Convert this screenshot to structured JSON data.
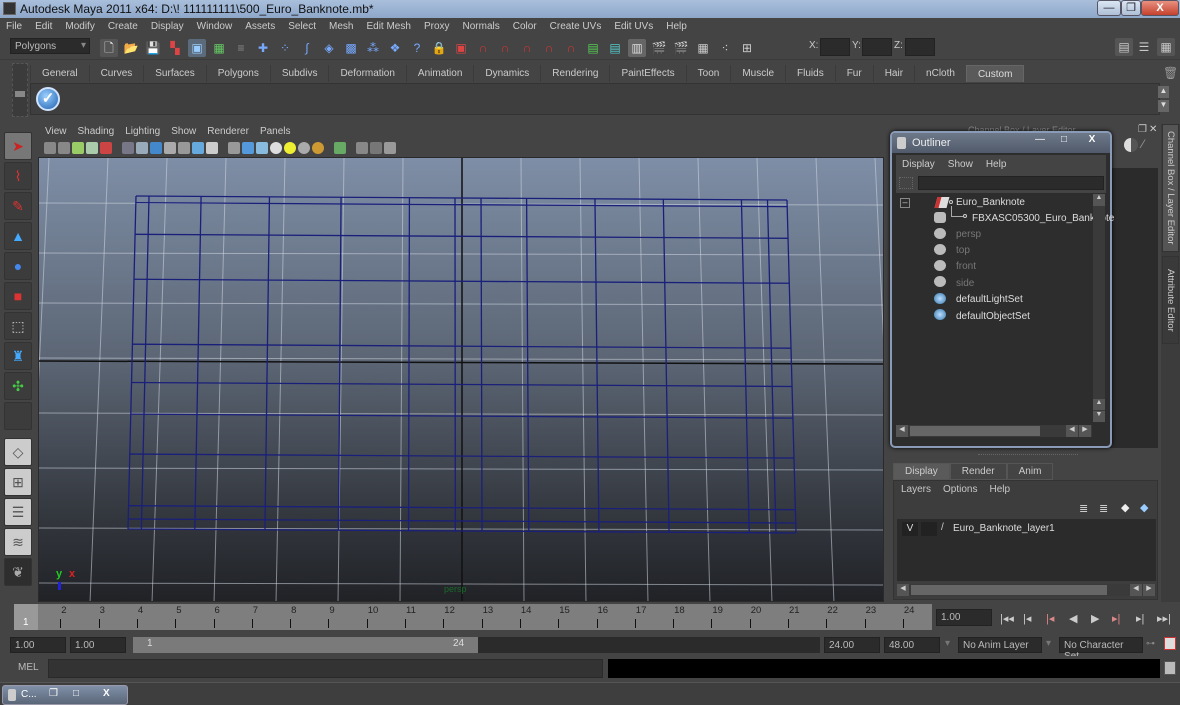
{
  "window": {
    "title": "Autodesk Maya 2011 x64: D:\\! 111111111\\500_Euro_Banknote.mb*",
    "minimize": "—",
    "restore": "❐",
    "close": "X"
  },
  "menubar": [
    "File",
    "Edit",
    "Modify",
    "Create",
    "Display",
    "Window",
    "Assets",
    "Select",
    "Mesh",
    "Edit Mesh",
    "Proxy",
    "Normals",
    "Color",
    "Create UVs",
    "Edit UVs",
    "Help"
  ],
  "statusline": {
    "mode": "Polygons",
    "x_label": "X:",
    "y_label": "Y:",
    "z_label": "Z:",
    "x_value": "",
    "y_value": "",
    "z_value": ""
  },
  "shelf": {
    "tabs": [
      "General",
      "Curves",
      "Surfaces",
      "Polygons",
      "Subdivs",
      "Deformation",
      "Animation",
      "Dynamics",
      "Rendering",
      "PaintEffects",
      "Toon",
      "Muscle",
      "Fluids",
      "Fur",
      "Hair",
      "nCloth",
      "Custom"
    ],
    "active_tab": "Custom",
    "items": [
      {
        "icon": "checkmark-shelf-icon"
      }
    ]
  },
  "toolbox": [
    {
      "name": "select-tool",
      "glyph": "➤"
    },
    {
      "name": "lasso-tool",
      "glyph": "⌇"
    },
    {
      "name": "paint-select-tool",
      "glyph": "✎"
    },
    {
      "name": "move-tool",
      "glyph": "▲"
    },
    {
      "name": "rotate-tool",
      "glyph": "●"
    },
    {
      "name": "scale-tool",
      "glyph": "■"
    },
    {
      "name": "universal-manipulator",
      "glyph": "⬚"
    },
    {
      "name": "soft-mod-tool",
      "glyph": "♜"
    },
    {
      "name": "show-manipulator",
      "glyph": "✣"
    },
    {
      "name": "last-tool",
      "glyph": ""
    }
  ],
  "layouts": [
    {
      "name": "single-perspective-layout"
    },
    {
      "name": "four-view-layout"
    },
    {
      "name": "persp-outliner-layout"
    },
    {
      "name": "persp-graph-layout"
    }
  ],
  "viewport": {
    "menus": [
      "View",
      "Shading",
      "Lighting",
      "Show",
      "Renderer",
      "Panels"
    ],
    "camera_label": "persp",
    "axis_x": "x",
    "axis_y": "y",
    "wire_color": "#1a1f7a"
  },
  "outliner": {
    "title": "Outliner",
    "menus": [
      "Display",
      "Show",
      "Help"
    ],
    "filter_value": "",
    "items": [
      {
        "label": "Euro_Banknote",
        "type": "transform",
        "dim": false
      },
      {
        "label": "FBXASC05300_Euro_Banknote",
        "type": "mesh",
        "dim": false
      },
      {
        "label": "persp",
        "type": "camera",
        "dim": true
      },
      {
        "label": "top",
        "type": "camera",
        "dim": true
      },
      {
        "label": "front",
        "type": "camera",
        "dim": true
      },
      {
        "label": "side",
        "type": "camera",
        "dim": true
      },
      {
        "label": "defaultLightSet",
        "type": "set",
        "dim": false
      },
      {
        "label": "defaultObjectSet",
        "type": "set",
        "dim": false
      }
    ]
  },
  "channel_box": {
    "header": "Channel Box / Layer Editor"
  },
  "side_tabs": [
    "Channel Box / Layer Editor",
    "Attribute Editor"
  ],
  "layer_editor": {
    "tabs": [
      "Display",
      "Render",
      "Anim"
    ],
    "active_tab": "Display",
    "menus": [
      "Layers",
      "Options",
      "Help"
    ],
    "layers": [
      {
        "visible": "V",
        "name": "Euro_Banknote_layer1"
      }
    ]
  },
  "timeline": {
    "frames": [
      "1",
      "2",
      "3",
      "4",
      "5",
      "6",
      "7",
      "8",
      "9",
      "10",
      "11",
      "12",
      "13",
      "14",
      "15",
      "16",
      "17",
      "18",
      "19",
      "20",
      "21",
      "22",
      "23",
      "24"
    ],
    "current_frame_marker": "1",
    "current_time": "1.00"
  },
  "playback": [
    "go-to-start",
    "step-back-frame",
    "step-back-key",
    "play-backward",
    "play-forward",
    "step-forward-key",
    "step-forward-frame",
    "go-to-end"
  ],
  "range": {
    "start_time": "1.00",
    "playback_start": "1.00",
    "range_start": "1",
    "range_end": "24",
    "playback_end": "24.00",
    "end_time": "48.00",
    "anim_layer": "No Anim Layer",
    "character_set": "No Character Set"
  },
  "command_line": {
    "label": "MEL",
    "value": "",
    "result": ""
  },
  "taskbar": {
    "item": "C..."
  }
}
